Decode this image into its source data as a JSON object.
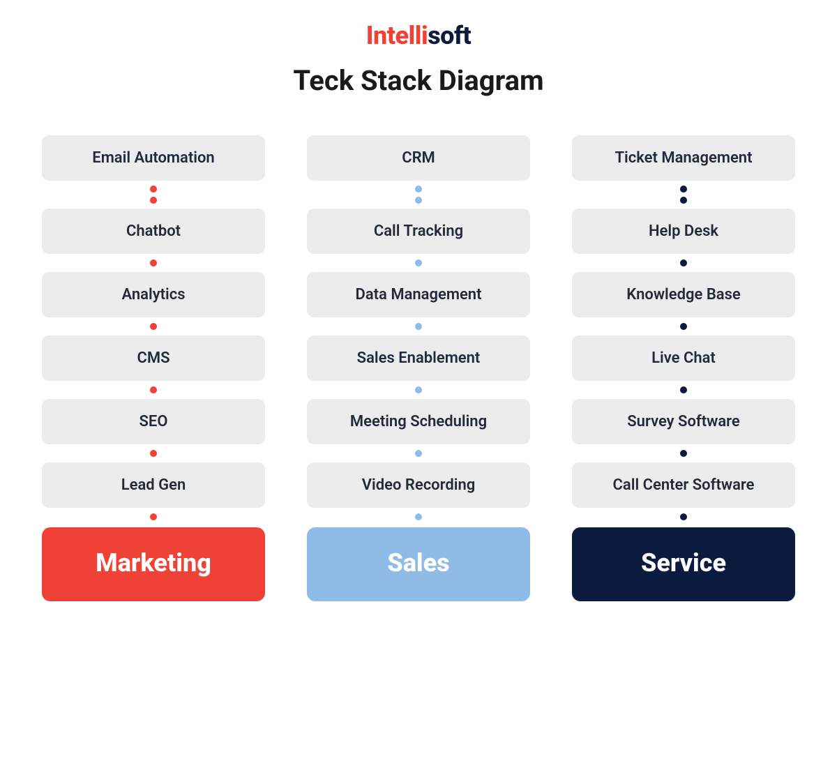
{
  "logo": {
    "part1": "Intelli",
    "part2": "soft"
  },
  "title": "Teck Stack Diagram",
  "columns": [
    {
      "name": "marketing",
      "color": "#ef4136",
      "label": "Marketing",
      "items": [
        "Email Automation",
        "Chatbot",
        "Analytics",
        "CMS",
        "SEO",
        "Lead Gen"
      ]
    },
    {
      "name": "sales",
      "color": "#8fbce6",
      "label": "Sales",
      "items": [
        "CRM",
        "Call Tracking",
        "Data Management",
        "Sales Enablement",
        "Meeting Scheduling",
        "Video Recording"
      ]
    },
    {
      "name": "service",
      "color": "#0a1b3d",
      "label": "Service",
      "items": [
        "Ticket Management",
        "Help Desk",
        "Knowledge Base",
        "Live Chat",
        "Survey Software",
        "Call Center Software"
      ]
    }
  ]
}
